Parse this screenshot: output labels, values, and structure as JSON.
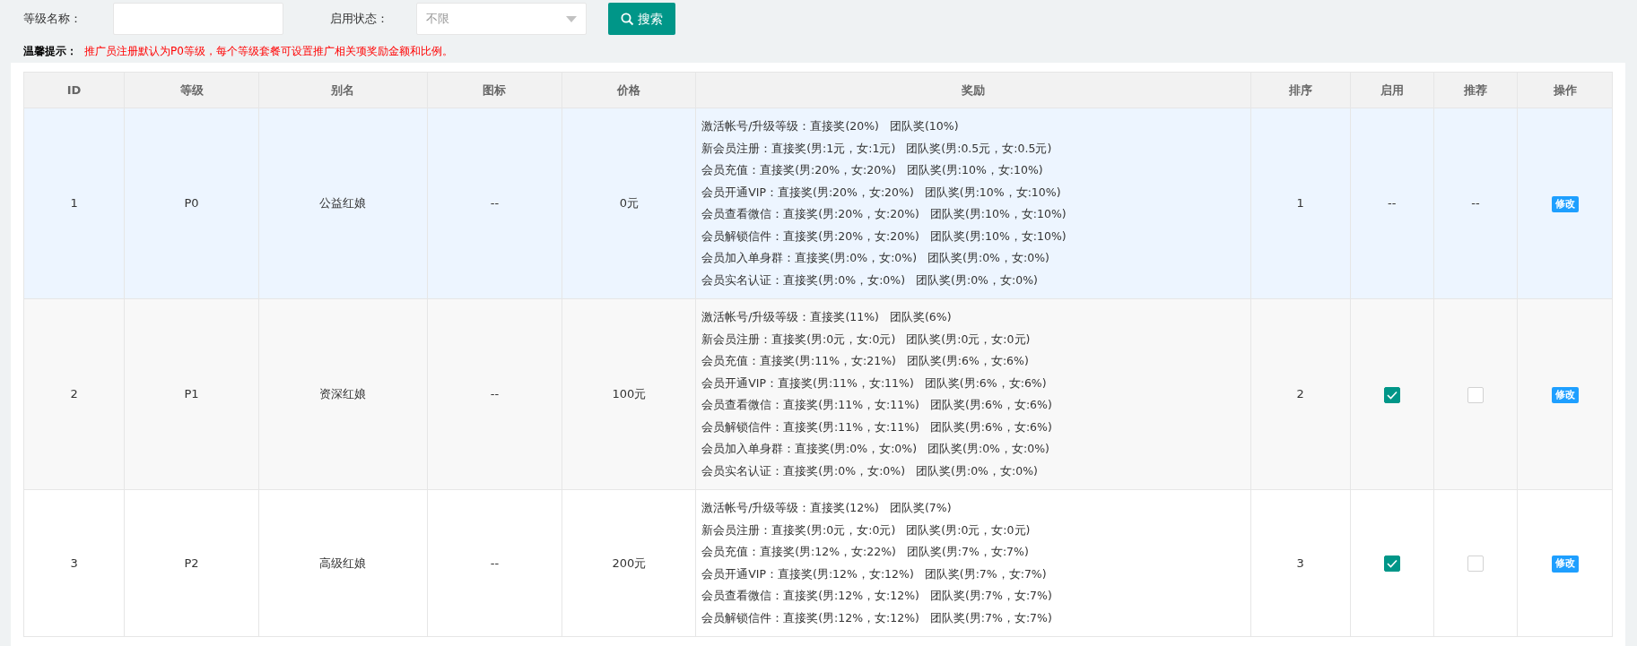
{
  "filters": {
    "level_name": {
      "label": "等级名称："
    },
    "status": {
      "label": "启用状态：",
      "value": "不限"
    },
    "search_button": "搜索"
  },
  "hint": {
    "label": "温馨提示：",
    "text": "推广员注册默认为P0等级，每个等级套餐可设置推广相关项奖励金额和比例。"
  },
  "table": {
    "columns": [
      "ID",
      "等级",
      "别名",
      "图标",
      "价格",
      "奖励",
      "排序",
      "启用",
      "推荐",
      "操作"
    ],
    "rows": [
      {
        "highlighted": true,
        "id": "1",
        "level": "P0",
        "alias": "公益红娘",
        "icon": "--",
        "price": "0元",
        "sort": "1",
        "enabled": {
          "kind": "text",
          "text": "--"
        },
        "recommended": {
          "kind": "text",
          "text": "--"
        },
        "action": "修改",
        "rewards": [
          {
            "direct": "激活帐号/升级等级：直接奖(20%)",
            "team": "团队奖(10%)"
          },
          {
            "direct": "新会员注册：直接奖(男:1元，女:1元)",
            "team": "团队奖(男:0.5元，女:0.5元)"
          },
          {
            "direct": "会员充值：直接奖(男:20%，女:20%)",
            "team": "团队奖(男:10%，女:10%)"
          },
          {
            "direct": "会员开通VIP：直接奖(男:20%，女:20%)",
            "team": "团队奖(男:10%，女:10%)"
          },
          {
            "direct": "会员查看微信：直接奖(男:20%，女:20%)",
            "team": "团队奖(男:10%，女:10%)"
          },
          {
            "direct": "会员解锁信件：直接奖(男:20%，女:20%)",
            "team": "团队奖(男:10%，女:10%)"
          },
          {
            "direct": "会员加入单身群：直接奖(男:0%，女:0%)",
            "team": "团队奖(男:0%，女:0%)"
          },
          {
            "direct": "会员实名认证：直接奖(男:0%，女:0%)",
            "team": "团队奖(男:0%，女:0%)"
          }
        ]
      },
      {
        "highlighted": false,
        "id": "2",
        "level": "P1",
        "alias": "资深红娘",
        "icon": "--",
        "price": "100元",
        "sort": "2",
        "enabled": {
          "kind": "checkbox",
          "checked": true
        },
        "recommended": {
          "kind": "checkbox",
          "checked": false
        },
        "action": "修改",
        "rewards": [
          {
            "direct": "激活帐号/升级等级：直接奖(11%)",
            "team": "团队奖(6%)"
          },
          {
            "direct": "新会员注册：直接奖(男:0元，女:0元)",
            "team": "团队奖(男:0元，女:0元)"
          },
          {
            "direct": "会员充值：直接奖(男:11%，女:21%)",
            "team": "团队奖(男:6%，女:6%)"
          },
          {
            "direct": "会员开通VIP：直接奖(男:11%，女:11%)",
            "team": "团队奖(男:6%，女:6%)"
          },
          {
            "direct": "会员查看微信：直接奖(男:11%，女:11%)",
            "team": "团队奖(男:6%，女:6%)"
          },
          {
            "direct": "会员解锁信件：直接奖(男:11%，女:11%)",
            "team": "团队奖(男:6%，女:6%)"
          },
          {
            "direct": "会员加入单身群：直接奖(男:0%，女:0%)",
            "team": "团队奖(男:0%，女:0%)"
          },
          {
            "direct": "会员实名认证：直接奖(男:0%，女:0%)",
            "team": "团队奖(男:0%，女:0%)"
          }
        ]
      },
      {
        "highlighted": false,
        "id": "3",
        "level": "P2",
        "alias": "高级红娘",
        "icon": "--",
        "price": "200元",
        "sort": "3",
        "enabled": {
          "kind": "checkbox",
          "checked": true
        },
        "recommended": {
          "kind": "checkbox",
          "checked": false
        },
        "action": "修改",
        "rewards": [
          {
            "direct": "激活帐号/升级等级：直接奖(12%)",
            "team": "团队奖(7%)"
          },
          {
            "direct": "新会员注册：直接奖(男:0元，女:0元)",
            "team": "团队奖(男:0元，女:0元)"
          },
          {
            "direct": "会员充值：直接奖(男:12%，女:22%)",
            "team": "团队奖(男:7%，女:7%)"
          },
          {
            "direct": "会员开通VIP：直接奖(男:12%，女:12%)",
            "team": "团队奖(男:7%，女:7%)"
          },
          {
            "direct": "会员查看微信：直接奖(男:12%，女:12%)",
            "team": "团队奖(男:7%，女:7%)"
          },
          {
            "direct": "会员解锁信件：直接奖(男:12%，女:12%)",
            "team": "团队奖(男:7%，女:7%)"
          }
        ]
      }
    ]
  }
}
